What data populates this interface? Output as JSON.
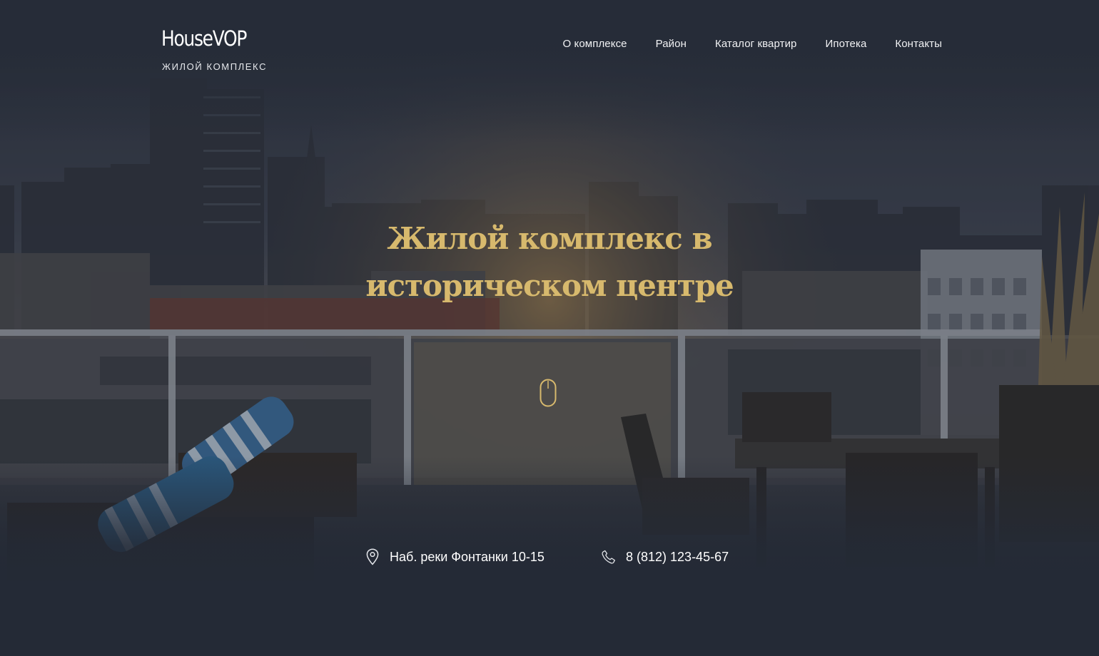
{
  "brand": {
    "name": "HouseVOP",
    "subtitle": "жилой комплекс"
  },
  "nav": {
    "items": [
      {
        "label": "О комплексе"
      },
      {
        "label": "Район"
      },
      {
        "label": "Каталог квартир"
      },
      {
        "label": "Ипотека"
      },
      {
        "label": "Контакты"
      }
    ]
  },
  "hero": {
    "title_line_1": "Жилой комплекс в",
    "title_line_2": "историческом центре",
    "scroll_icon": "mouse-scroll-icon"
  },
  "contacts": {
    "address": "Наб. реки Фонтанки 10-15",
    "address_icon": "location-pin-icon",
    "phone": "8 (812) 123-45-67",
    "phone_icon": "phone-icon"
  },
  "colors": {
    "background": "#242a36",
    "accent_gold": "#d7b96d",
    "text_light": "#ffffff"
  }
}
